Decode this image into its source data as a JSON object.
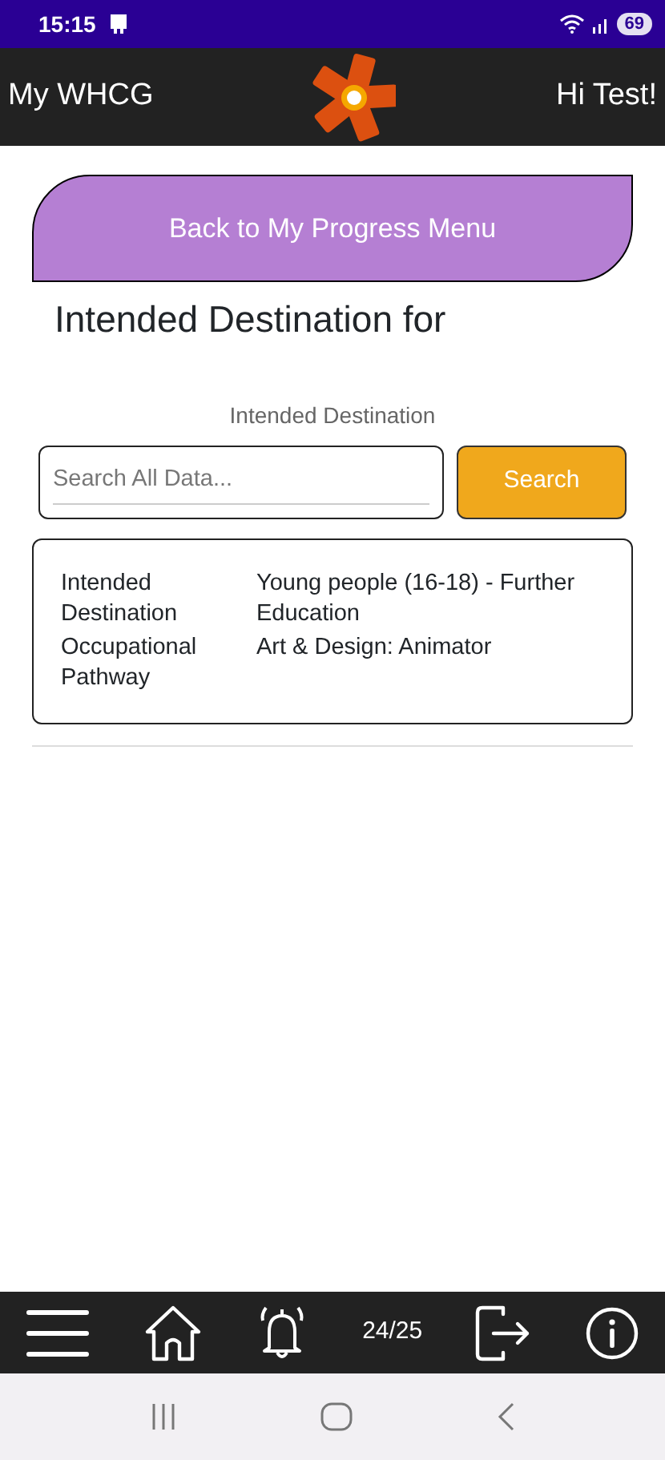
{
  "status_bar": {
    "time": "15:15",
    "battery": "69"
  },
  "app_bar": {
    "title": "My WHCG",
    "greeting": "Hi Test!"
  },
  "back_button": "Back to My Progress Menu",
  "heading": "Intended Destination for",
  "section_label": "Intended Destination",
  "search": {
    "placeholder": "Search All Data...",
    "button": "Search"
  },
  "details": [
    {
      "label": "Intended Destination",
      "value": "Young people (16-18) - Further Education"
    },
    {
      "label": "Occupational Pathway",
      "value": "Art & Design: Animator"
    }
  ],
  "bottom_bar": {
    "counter": "24/25"
  }
}
